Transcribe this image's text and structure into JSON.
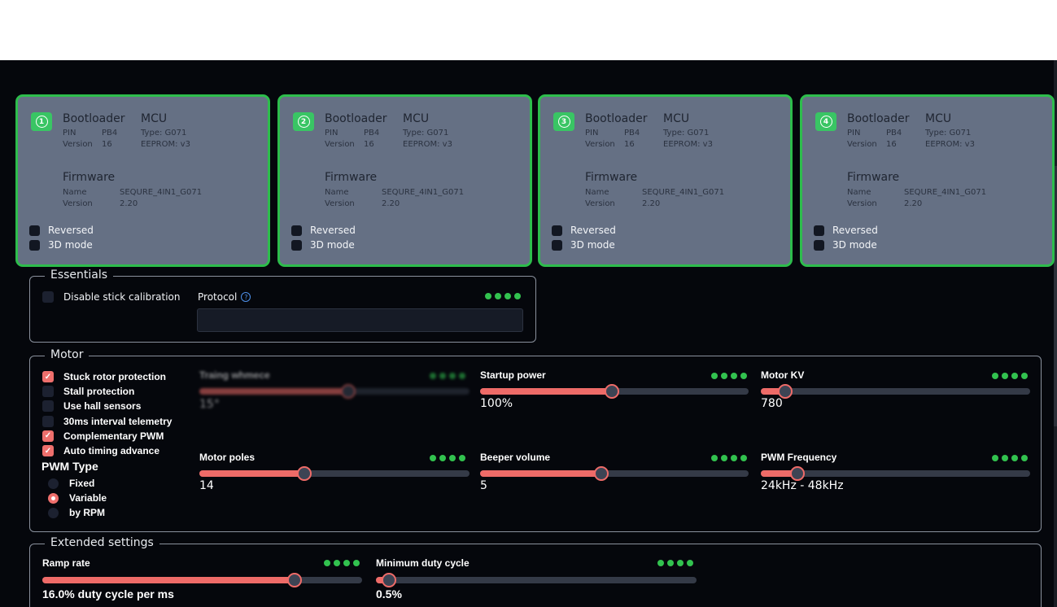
{
  "escs": [
    {
      "num": "1",
      "bootloader": "Bootloader",
      "pin_label": "PIN",
      "pin": "PB4",
      "version_label": "Version",
      "version": "16",
      "mcu": "MCU",
      "type": "Type: G071",
      "eeprom": "EEPROM: v3",
      "firmware": "Firmware",
      "name_label": "Name",
      "name": "SEQURE_4IN1_G071",
      "fw_version_label": "Version",
      "fw_version": "2.20",
      "reversed": "Reversed",
      "mode3d": "3D mode"
    },
    {
      "num": "2",
      "bootloader": "Bootloader",
      "pin_label": "PIN",
      "pin": "PB4",
      "version_label": "Version",
      "version": "16",
      "mcu": "MCU",
      "type": "Type: G071",
      "eeprom": "EEPROM: v3",
      "firmware": "Firmware",
      "name_label": "Name",
      "name": "SEQURE_4IN1_G071",
      "fw_version_label": "Version",
      "fw_version": "2.20",
      "reversed": "Reversed",
      "mode3d": "3D mode"
    },
    {
      "num": "3",
      "bootloader": "Bootloader",
      "pin_label": "PIN",
      "pin": "PB4",
      "version_label": "Version",
      "version": "16",
      "mcu": "MCU",
      "type": "Type: G071",
      "eeprom": "EEPROM: v3",
      "firmware": "Firmware",
      "name_label": "Name",
      "name": "SEQURE_4IN1_G071",
      "fw_version_label": "Version",
      "fw_version": "2.20",
      "reversed": "Reversed",
      "mode3d": "3D mode"
    },
    {
      "num": "4",
      "bootloader": "Bootloader",
      "pin_label": "PIN",
      "pin": "PB4",
      "version_label": "Version",
      "version": "16",
      "mcu": "MCU",
      "type": "Type: G071",
      "eeprom": "EEPROM: v3",
      "firmware": "Firmware",
      "name_label": "Name",
      "name": "SEQURE_4IN1_G071",
      "fw_version_label": "Version",
      "fw_version": "2.20",
      "reversed": "Reversed",
      "mode3d": "3D mode"
    }
  ],
  "essentials": {
    "legend": "Essentials",
    "disable_stick": "Disable stick calibration",
    "protocol_label": "Protocol",
    "protocol_value": ""
  },
  "motor": {
    "legend": "Motor",
    "options": [
      {
        "label": "Stuck rotor protection",
        "checked": true
      },
      {
        "label": "Stall protection",
        "checked": false
      },
      {
        "label": "Use hall sensors",
        "checked": false
      },
      {
        "label": "30ms interval telemetry",
        "checked": false
      },
      {
        "label": "Complementary PWM",
        "checked": true
      },
      {
        "label": "Auto timing advance",
        "checked": true
      }
    ],
    "pwm_type_label": "PWM Type",
    "pwm_types": [
      {
        "label": "Fixed",
        "selected": false
      },
      {
        "label": "Variable",
        "selected": true
      },
      {
        "label": "by RPM",
        "selected": false
      }
    ],
    "timing": {
      "label": "Traing whmece",
      "value": "15°",
      "fraction": 0.55
    },
    "startup_power": {
      "label": "Startup power",
      "value": "100%",
      "fraction": 0.49
    },
    "motor_kv": {
      "label": "Motor KV",
      "value": "780",
      "fraction": 0.09
    },
    "motor_poles": {
      "label": "Motor poles",
      "value": "14",
      "fraction": 0.39
    },
    "beeper_volume": {
      "label": "Beeper volume",
      "value": "5",
      "fraction": 0.45
    },
    "pwm_frequency": {
      "label": "PWM Frequency",
      "value": "24kHz - 48kHz",
      "fraction": 0.135
    }
  },
  "extended": {
    "legend": "Extended settings",
    "ramp_rate": {
      "label": "Ramp rate",
      "value": "16.0% duty cycle per ms",
      "fraction": 0.79
    },
    "min_duty": {
      "label": "Minimum duty cycle",
      "value": "0.5%",
      "fraction": 0.04
    }
  },
  "colors": {
    "accent": "#ee6b68",
    "ok": "#32c24f",
    "card": "#657084",
    "card_border": "#2dbd4c"
  }
}
